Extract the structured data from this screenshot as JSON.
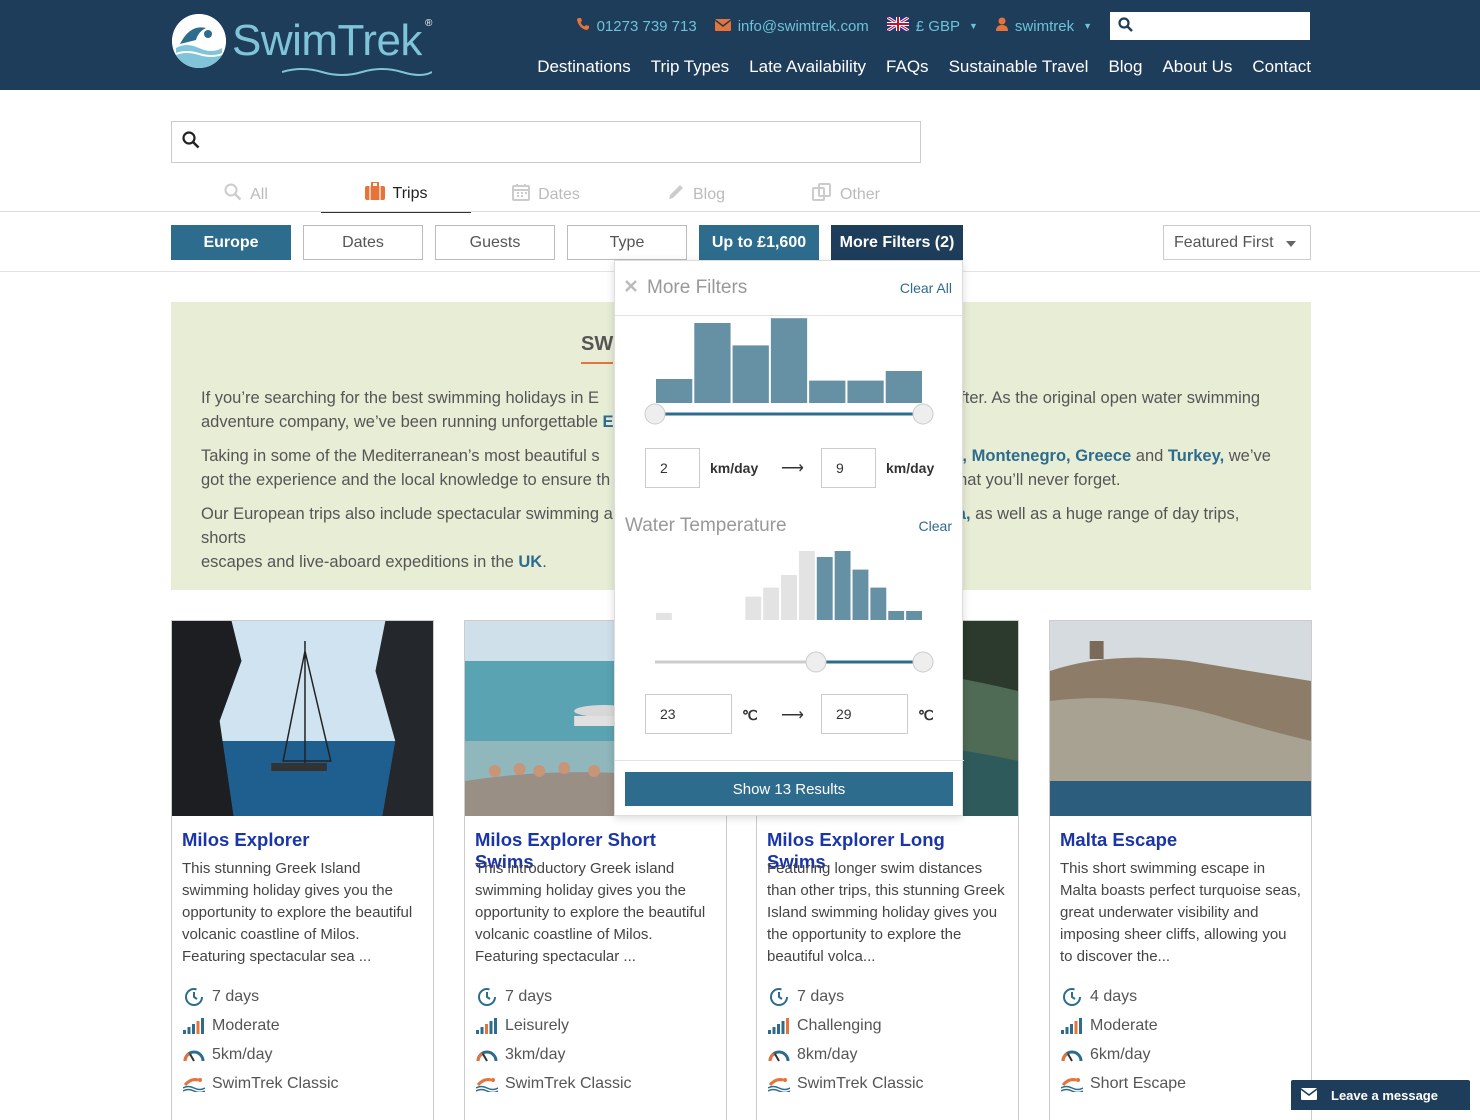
{
  "header": {
    "logo_text": "SwimTrek",
    "phone": "01273 739 713",
    "email": "info@swimtrek.com",
    "currency": "£ GBP",
    "account": "swimtrek",
    "nav": [
      "Destinations",
      "Trip Types",
      "Late Availability",
      "FAQs",
      "Sustainable Travel",
      "Blog",
      "About Us",
      "Contact"
    ]
  },
  "search": {
    "placeholder": ""
  },
  "tabs": [
    {
      "label": "All",
      "icon": "search-icon"
    },
    {
      "label": "Trips",
      "icon": "suitcase-icon",
      "active": true
    },
    {
      "label": "Dates",
      "icon": "calendar-icon"
    },
    {
      "label": "Blog",
      "icon": "pencil-icon"
    },
    {
      "label": "Other",
      "icon": "copy-icon"
    }
  ],
  "filters": {
    "region": "Europe",
    "dates": "Dates",
    "guests": "Guests",
    "type": "Type",
    "price": "Up to £1,600",
    "more": "More Filters (2)",
    "sort": "Featured First"
  },
  "intro": {
    "title_visible": "SW",
    "p1a": "If you’re searching for the best swimming holidays in E",
    "p1b": "after. As the original open water swimming",
    "p1c": "adventure company, we’ve been running unforgettable ",
    "p1link": "E",
    "p2a": "Taking in some of the Mediterranean’s most beautiful s",
    "p2links": [
      "ia,",
      "Montenegro,",
      "Greece",
      "Turkey,"
    ],
    "p2and": "and",
    "p2b": "we’ve",
    "p2c": "got the experience and the local knowledge to ensure th",
    "p2d": "hat you’ll never forget.",
    "p3a": "Our European trips also include spectacular swimming a",
    "p3link": "a,",
    "p3b": "as well as a huge range of day trips, shorts",
    "p3c": "escapes and live-aboard expeditions in the ",
    "p3uk": "UK",
    "p3end": "."
  },
  "more_filters": {
    "title": "More Filters",
    "clear_all": "Clear All",
    "distance": {
      "min": "2",
      "max": "9",
      "unit": "km/day",
      "histogram": [
        0.3,
        1.0,
        0.72,
        1.06,
        0.28,
        0.28,
        0.4
      ]
    },
    "water_temp": {
      "title": "Water Temperature",
      "clear": "Clear",
      "min": "23",
      "max": "29",
      "unit": "℃",
      "histogram": [
        0.08,
        0,
        0,
        0,
        0,
        0.26,
        0.36,
        0.5,
        1.0,
        0.7,
        1.0,
        0.56,
        0.36,
        0.1,
        0.1
      ],
      "selected_from_index": 9
    },
    "show_button": "Show 13 Results"
  },
  "cards": [
    {
      "title": "Milos Explorer",
      "desc": "This stunning Greek Island swimming holiday gives you the opportunity to explore the beautiful volcanic coastline of Milos. Featuring spectacular sea ...",
      "days": "7 days",
      "level": "Moderate",
      "distance": "5km/day",
      "type": "SwimTrek Classic"
    },
    {
      "title": "Milos Explorer Short Swims",
      "desc": "This introductory Greek island swimming holiday gives you the opportunity to explore the beautiful volcanic coastline of Milos. Featuring spectacular ...",
      "days": "7 days",
      "level": "Leisurely",
      "distance": "3km/day",
      "type": "SwimTrek Classic"
    },
    {
      "title": "Milos Explorer Long Swims",
      "desc": "Featuring longer swim distances than other trips, this stunning Greek Island swimming holiday gives you the opportunity to explore the beautiful volca...",
      "days": "7 days",
      "level": "Challenging",
      "distance": "8km/day",
      "type": "SwimTrek Classic"
    },
    {
      "title": "Malta Escape",
      "desc": "This short swimming escape in Malta boasts perfect turquoise seas, great underwater visibility and imposing sheer cliffs, allowing you to discover the...",
      "days": "4 days",
      "level": "Moderate",
      "distance": "6km/day",
      "type": "Short Escape"
    }
  ],
  "chat": {
    "label": "Leave a message"
  },
  "colors": {
    "navy": "#1e3d5a",
    "teal": "#2e6c8e",
    "orange": "#e6733a",
    "aqua": "#6cc2d8",
    "green_bg": "#e8edd6"
  }
}
